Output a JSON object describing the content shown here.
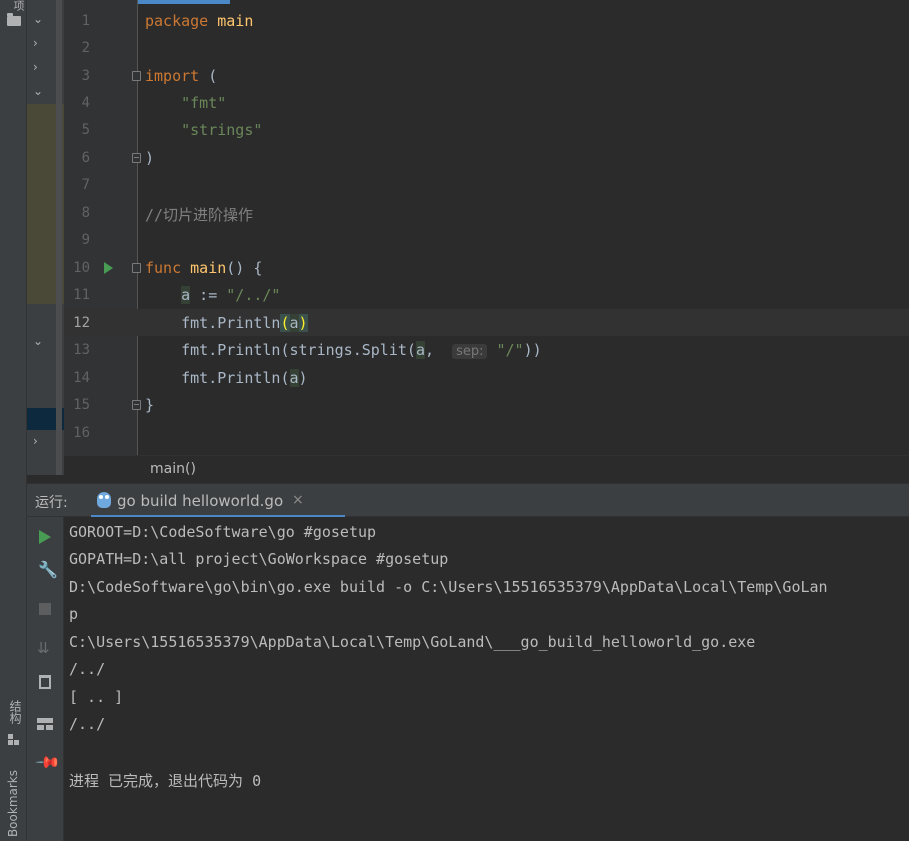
{
  "tool_stripe": {
    "project_label": "项",
    "structure_label": "结构",
    "bookmarks_label": "Bookmarks"
  },
  "editor": {
    "lines": [
      {
        "num": "1"
      },
      {
        "num": "2"
      },
      {
        "num": "3"
      },
      {
        "num": "4"
      },
      {
        "num": "5"
      },
      {
        "num": "6"
      },
      {
        "num": "7"
      },
      {
        "num": "8"
      },
      {
        "num": "9"
      },
      {
        "num": "10"
      },
      {
        "num": "11"
      },
      {
        "num": "12"
      },
      {
        "num": "13"
      },
      {
        "num": "14"
      },
      {
        "num": "15"
      },
      {
        "num": "16"
      }
    ],
    "tokens": {
      "package_kw": "package",
      "package_name": "main",
      "import_kw": "import",
      "open_paren": "(",
      "import_fmt": "\"fmt\"",
      "import_strings": "\"strings\"",
      "close_paren": ")",
      "comment": "//切片进阶操作",
      "func_kw": "func",
      "func_name": "main",
      "func_sig": "() {",
      "var_a": "a",
      "assign": " := ",
      "a_value": "\"/../\"",
      "fmt_pkg": "fmt",
      "dot": ".",
      "println": "Println",
      "lparen": "(",
      "rparen": ")",
      "strings_pkg": "strings",
      "split": "Split",
      "comma": ", ",
      "sep_hint": "sep:",
      "sep_value": "\"/\"",
      "close_two": "))",
      "close_brace": "}"
    }
  },
  "breadcrumb": {
    "path": "main()"
  },
  "run_panel": {
    "label": "运行:",
    "tab_label": "go build helloworld.go",
    "tab_close": "×",
    "console_lines": [
      "GOROOT=D:\\CodeSoftware\\go #gosetup",
      "GOPATH=D:\\all project\\GoWorkspace #gosetup",
      "D:\\CodeSoftware\\go\\bin\\go.exe build -o C:\\Users\\15516535379\\AppData\\Local\\Temp\\GoLan",
      "p",
      "C:\\Users\\15516535379\\AppData\\Local\\Temp\\GoLand\\___go_build_helloworld_go.exe",
      "/../",
      "[ .. ]",
      "/../",
      "",
      "进程 已完成，退出代码为 0"
    ]
  }
}
